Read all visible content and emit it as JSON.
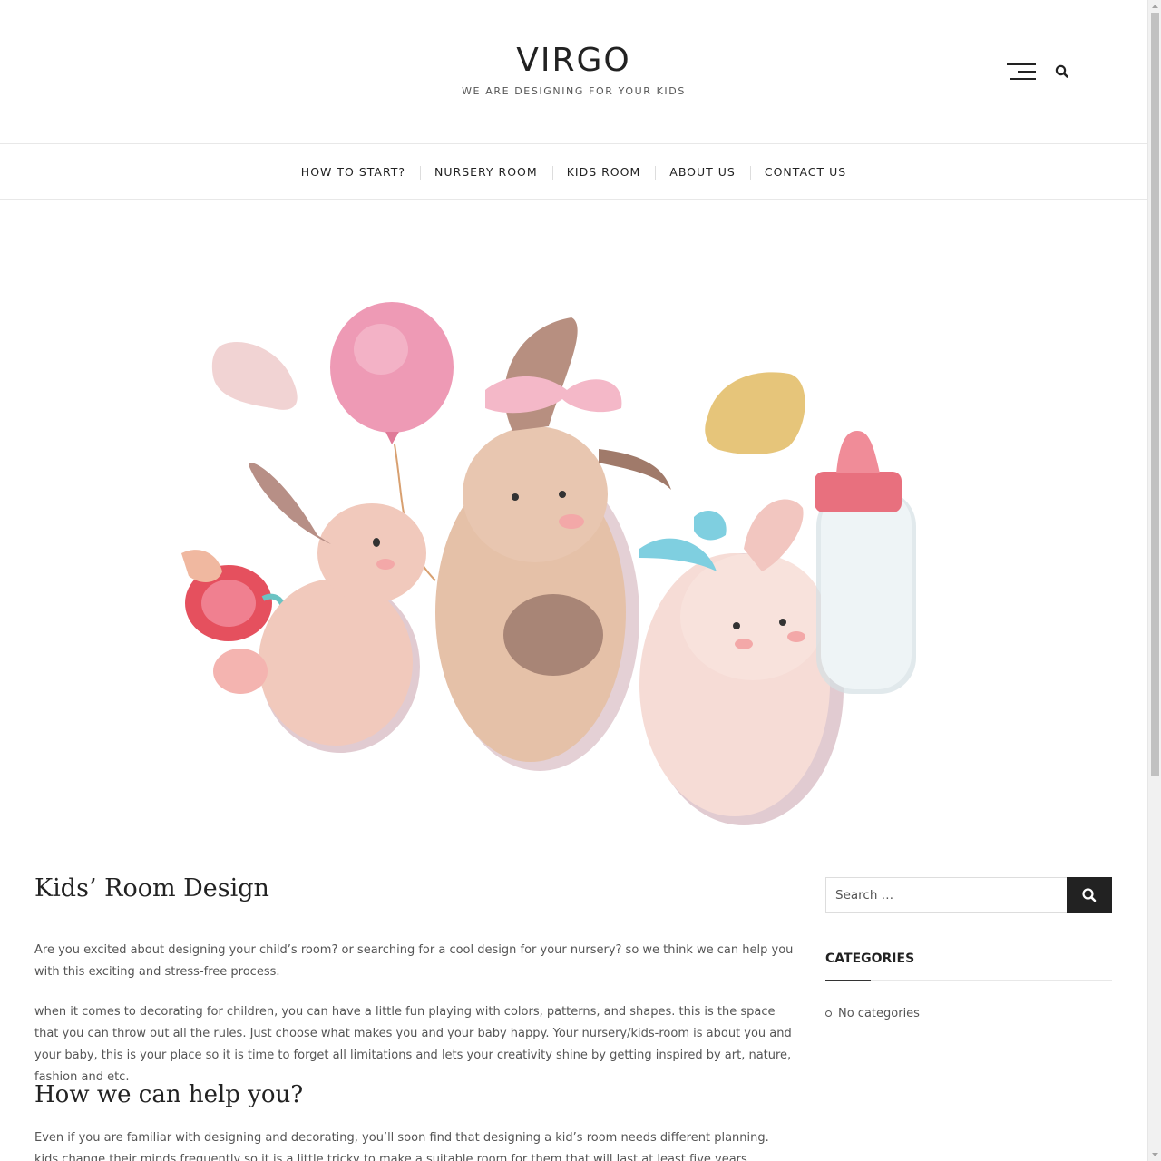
{
  "site": {
    "title": "VIRGO",
    "tagline": "WE ARE DESIGNING FOR YOUR KIDS"
  },
  "nav": {
    "items": [
      {
        "label": "HOW TO START?"
      },
      {
        "label": "NURSERY ROOM"
      },
      {
        "label": "KIDS ROOM"
      },
      {
        "label": "ABOUT US"
      },
      {
        "label": "CONTACT US"
      }
    ]
  },
  "hero": {
    "alt": "Watercolor bunnies with balloon, pacifier and baby bottle",
    "icon": "bunny-illustration"
  },
  "post": {
    "title": "Kids’ Room Design",
    "paragraph1": "Are you excited about designing your child’s room? or searching for a cool design for your nursery? so we think we can help you with this exciting and stress-free process.",
    "paragraph2": "when it comes to decorating for children, you can have a little fun playing with colors, patterns, and shapes. this is the space that you can throw out all the rules. Just choose what makes you and your baby happy. Your nursery/kids-room is about you and your baby, this is your place so it is time to forget all limitations and lets your creativity shine by getting inspired by art, nature, fashion and etc.",
    "heading2": "How we can help you?",
    "paragraph3": "Even if you are familiar with designing and decorating, you’ll soon find that designing a kid’s room needs different planning. kids change their minds frequently so it is a little tricky to make a suitable room for them that will last at least five years."
  },
  "sidebar": {
    "search": {
      "placeholder": "Search …",
      "value": ""
    },
    "categories": {
      "title": "CATEGORIES",
      "empty": "No categories"
    }
  },
  "colors": {
    "accent": "#222222",
    "text": "#555555",
    "border": "#e8e8e8"
  }
}
